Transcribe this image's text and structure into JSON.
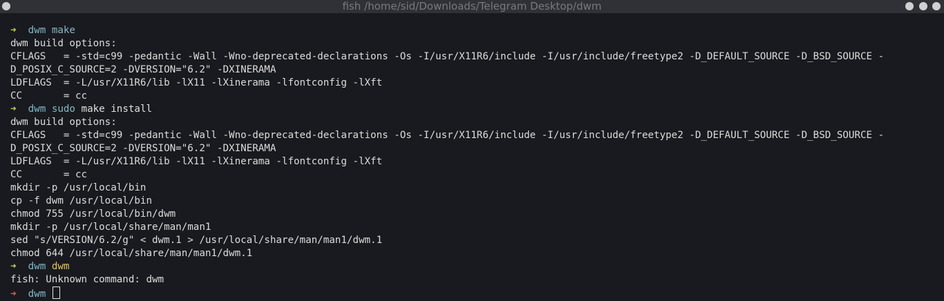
{
  "window": {
    "title": "fish /home/sid/Downloads/Telegram Desktop/dwm"
  },
  "icons": {
    "prompt_arrow": "→",
    "window_buttons": [
      "menu-dot",
      "minimize-dot",
      "maximize-dot",
      "close-dot"
    ]
  },
  "colors": {
    "background": "#191a1f",
    "titlebar": "#2f3136",
    "prompt_ok": "#b7d155",
    "prompt_error": "#d7625b",
    "directory": "#7fb9c9",
    "unknown_command": "#e4c465"
  },
  "terminal": {
    "prompt1": {
      "arrow": "➜",
      "dir": "dwm",
      "cmd": "make"
    },
    "out1": [
      "dwm build options:",
      "CFLAGS   = -std=c99 -pedantic -Wall -Wno-deprecated-declarations -Os -I/usr/X11R6/include -I/usr/include/freetype2 -D_DEFAULT_SOURCE -D_BSD_SOURCE -",
      "D_POSIX_C_SOURCE=2 -DVERSION=\"6.2\" -DXINERAMA",
      "LDFLAGS  = -L/usr/X11R6/lib -lX11 -lXinerama -lfontconfig -lXft",
      "CC       = cc"
    ],
    "prompt2": {
      "arrow": "➜",
      "dir": "dwm",
      "cmd": "sudo",
      "args": "make install"
    },
    "out2": [
      "dwm build options:",
      "CFLAGS   = -std=c99 -pedantic -Wall -Wno-deprecated-declarations -Os -I/usr/X11R6/include -I/usr/include/freetype2 -D_DEFAULT_SOURCE -D_BSD_SOURCE -",
      "D_POSIX_C_SOURCE=2 -DVERSION=\"6.2\" -DXINERAMA",
      "LDFLAGS  = -L/usr/X11R6/lib -lX11 -lXinerama -lfontconfig -lXft",
      "CC       = cc",
      "mkdir -p /usr/local/bin",
      "cp -f dwm /usr/local/bin",
      "chmod 755 /usr/local/bin/dwm",
      "mkdir -p /usr/local/share/man/man1",
      "sed \"s/VERSION/6.2/g\" < dwm.1 > /usr/local/share/man/man1/dwm.1",
      "chmod 644 /usr/local/share/man/man1/dwm.1"
    ],
    "prompt3": {
      "arrow": "➜",
      "dir": "dwm",
      "cmd": "dwm"
    },
    "out3": [
      "fish: Unknown command: dwm"
    ],
    "prompt4": {
      "arrow": "➜",
      "dir": "dwm"
    }
  }
}
